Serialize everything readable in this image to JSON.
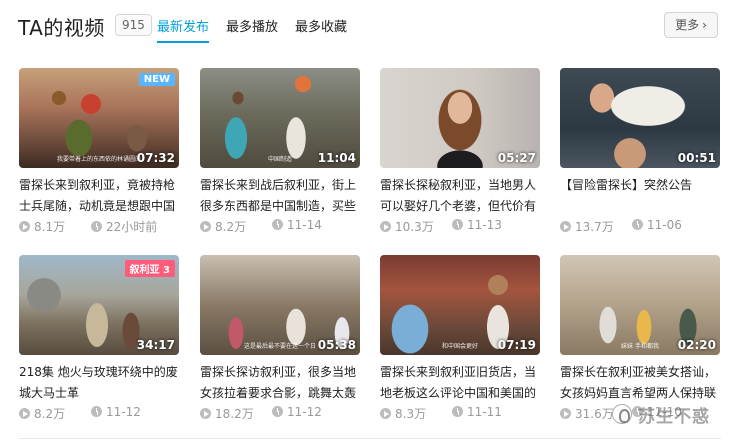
{
  "header": {
    "title": "TA的视频",
    "count": "915",
    "tabs": [
      {
        "label": "最新发布",
        "active": true
      },
      {
        "label": "最多播放",
        "active": false
      },
      {
        "label": "最多收藏",
        "active": false
      }
    ],
    "more_label": "更多"
  },
  "accent_color": "#00a1d6",
  "videos": [
    {
      "title": "雷探长来到叙利亚，竟被持枪士兵尾随，动机竟是想跟中国",
      "plays": "8.1万",
      "date": "22小时前",
      "duration": "07:32",
      "badge": "NEW",
      "caption": "我要带着上的东西依的林诵圆的"
    },
    {
      "title": "雷探长来到战后叙利亚，街上很多东西都是中国制造，买些",
      "plays": "8.2万",
      "date": "11-14",
      "duration": "11:04",
      "badge": "",
      "caption": "中国制造"
    },
    {
      "title": "雷探长探秘叙利亚，当地男人可以娶好几个老婆，但代价有",
      "plays": "10.3万",
      "date": "11-13",
      "duration": "05:27",
      "badge": "",
      "caption": ""
    },
    {
      "title": "【冒险雷探长】突然公告",
      "plays": "13.7万",
      "date": "11-06",
      "duration": "00:51",
      "badge": "",
      "caption": ""
    },
    {
      "title": "218集 炮火与玫瑰环绕中的废城大马士革",
      "plays": "8.2万",
      "date": "11-12",
      "duration": "34:17",
      "badge": "叙利亚 3",
      "caption": ""
    },
    {
      "title": "雷探长探访叙利亚，很多当地女孩拉着要求合影，跳舞太轰动",
      "plays": "18.2万",
      "date": "11-12",
      "duration": "05:38",
      "badge": "",
      "caption": "这是最后最不要在这一个日"
    },
    {
      "title": "雷探长来到叙利亚旧货店，当地老板这么评论中国和美国的",
      "plays": "8.3万",
      "date": "11-11",
      "duration": "07:19",
      "badge": "",
      "caption": "和中国会更好"
    },
    {
      "title": "雷探长在叙利亚被美女搭讪，女孩妈妈直言希望两人保持联",
      "plays": "31.6万",
      "date": "11-10",
      "duration": "02:20",
      "badge": "",
      "caption": "妹妹 手和都我"
    }
  ],
  "watermark": "苏生不惑",
  "icons": {
    "plays": "play-count-icon",
    "date": "clock-icon"
  }
}
